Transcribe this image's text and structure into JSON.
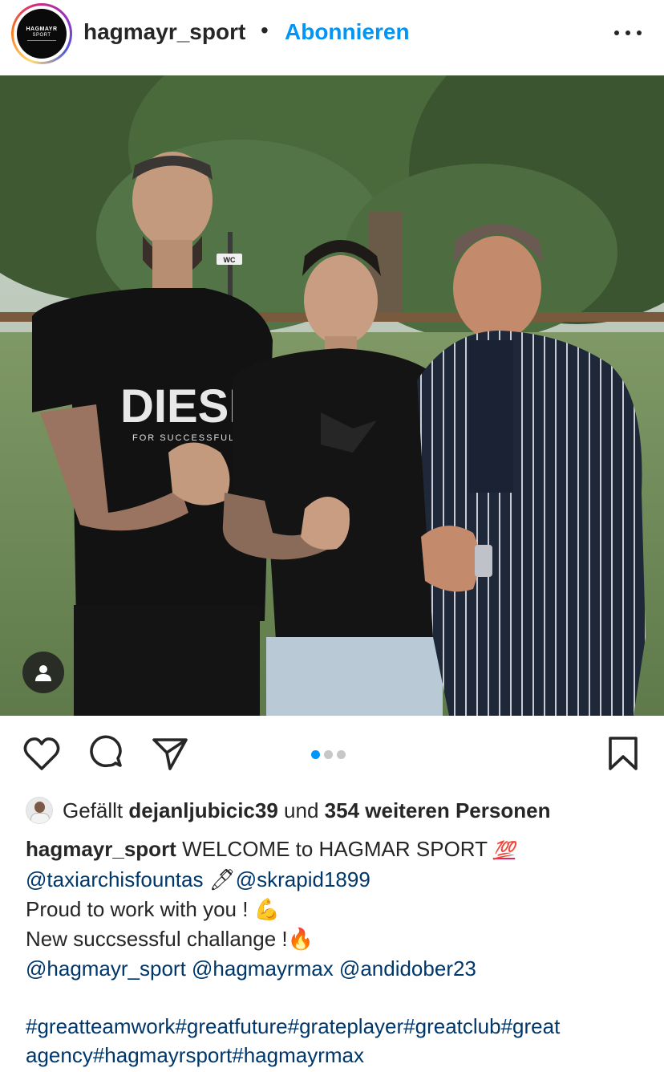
{
  "header": {
    "username": "hagmayr_sport",
    "separator": "•",
    "follow_label": "Abonnieren",
    "avatar_logo_top": "HAGMAYR",
    "avatar_logo_bottom": "SPORT",
    "more_icon": "more-horizontal-icon"
  },
  "post": {
    "image_count": 3,
    "current_image": 1,
    "photo_shirt_text_left": "DIESEL",
    "photo_shirt_subtext_left": "FOR SUCCESSFUL L",
    "photo_sign_text": "WC"
  },
  "actions": {
    "icons": [
      "heart-icon",
      "comment-icon",
      "share-icon",
      "bookmark-icon"
    ]
  },
  "likes": {
    "prefix": "Gefällt",
    "liker": "dejanljubicic39",
    "connector": "und",
    "others": "354 weiteren Personen"
  },
  "caption": {
    "author": "hagmayr_sport",
    "line1_text": "WELCOME to HAGMAR SPORT",
    "line1_emoji": "💯",
    "line2_mention1": "@taxiarchisfountas",
    "line2_emoji": "🖊",
    "line2_mention2": "@skrapid1899",
    "line3_text": "Proud to work with you !",
    "line3_emoji": "💪",
    "line4_text": "New succsessful challange !",
    "line4_emoji": "🔥",
    "line5_mentions": "@hagmayr_sport @hagmayrmax @andidober23",
    "hashtags_line1": "#greatteamwork#greatfuture#grateplayer#greatclub#great",
    "hashtags_line2": "agency#hagmayrsport#hagmayrmax"
  },
  "colors": {
    "link": "#00376b",
    "accent": "#0095f6",
    "text": "#262626"
  }
}
